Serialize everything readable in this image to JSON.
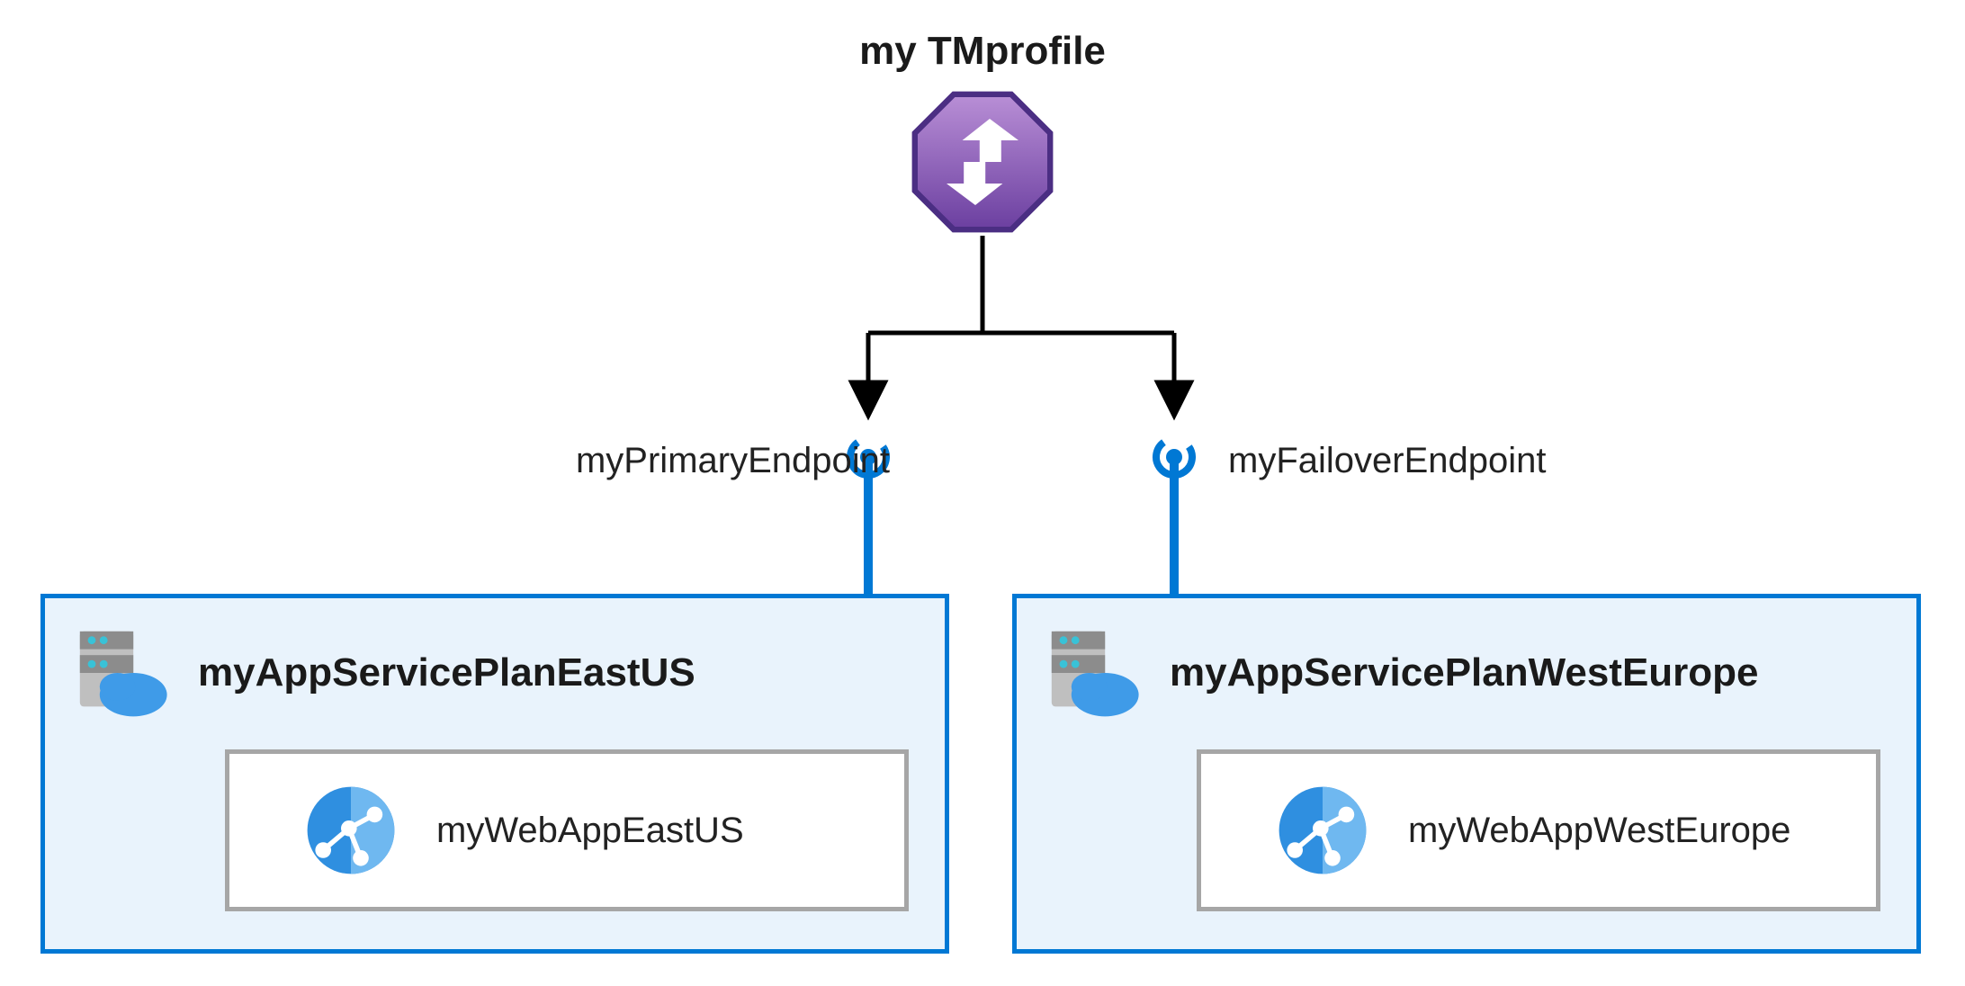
{
  "trafficManager": {
    "title": "my TMprofile"
  },
  "endpoints": {
    "primary": {
      "label": "myPrimaryEndpoint"
    },
    "failover": {
      "label": "myFailoverEndpoint"
    }
  },
  "regions": {
    "left": {
      "appServicePlan": "myAppServicePlanEastUS",
      "webApp": "myWebAppEastUS"
    },
    "right": {
      "appServicePlan": "myAppServicePlanWestEurope",
      "webApp": "myWebAppWestEurope"
    }
  }
}
